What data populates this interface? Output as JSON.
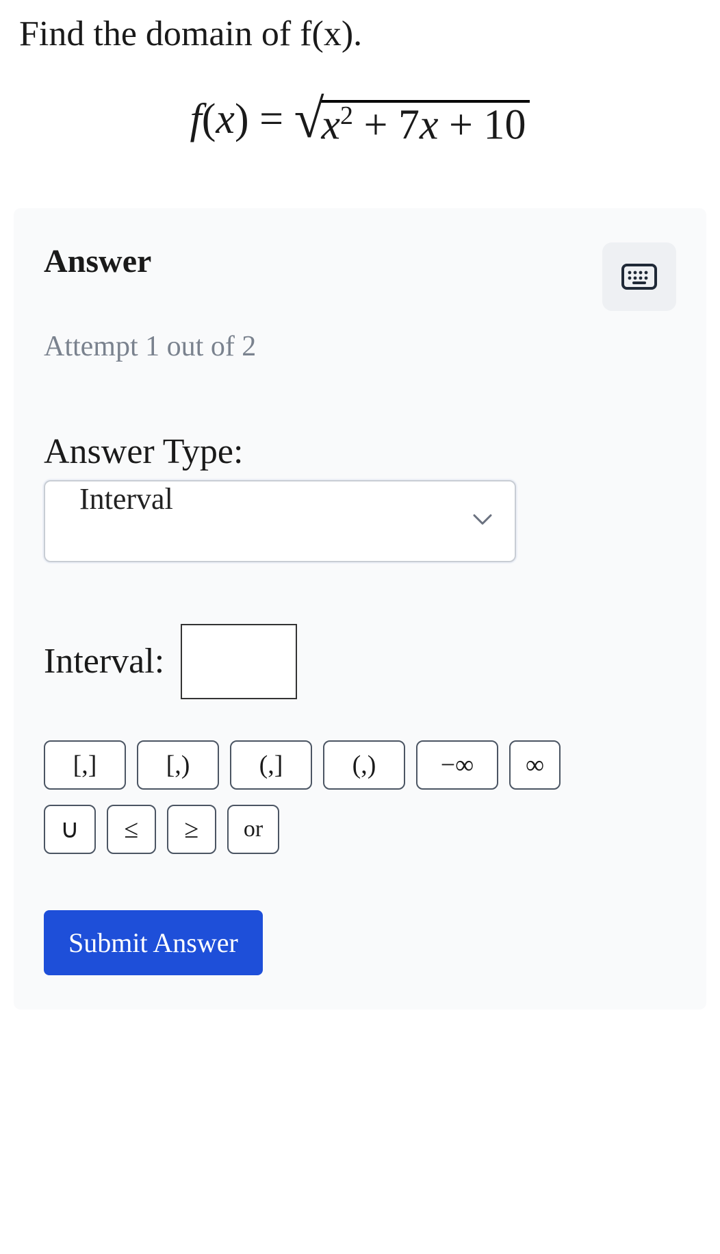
{
  "prompt": "Find the domain of f(x).",
  "equation": {
    "lhs_func": "f",
    "lhs_var": "x",
    "op": "=",
    "radicand_term1_var": "x",
    "radicand_term1_exp": "2",
    "radicand_plus1": "+",
    "radicand_term2_coef": "7",
    "radicand_term2_var": "x",
    "radicand_plus2": "+",
    "radicand_const": "10"
  },
  "answer": {
    "title": "Answer",
    "attempt": "Attempt 1 out of 2",
    "type_label": "Answer Type:",
    "type_value": "Interval",
    "interval_label": "Interval:",
    "interval_value": "",
    "symbols_row1": [
      "[,]",
      "[,)",
      "(,]",
      "(,)",
      "−∞",
      "∞"
    ],
    "symbols_row2": [
      "∪",
      "≤",
      "≥",
      "or"
    ],
    "submit": "Submit Answer"
  }
}
